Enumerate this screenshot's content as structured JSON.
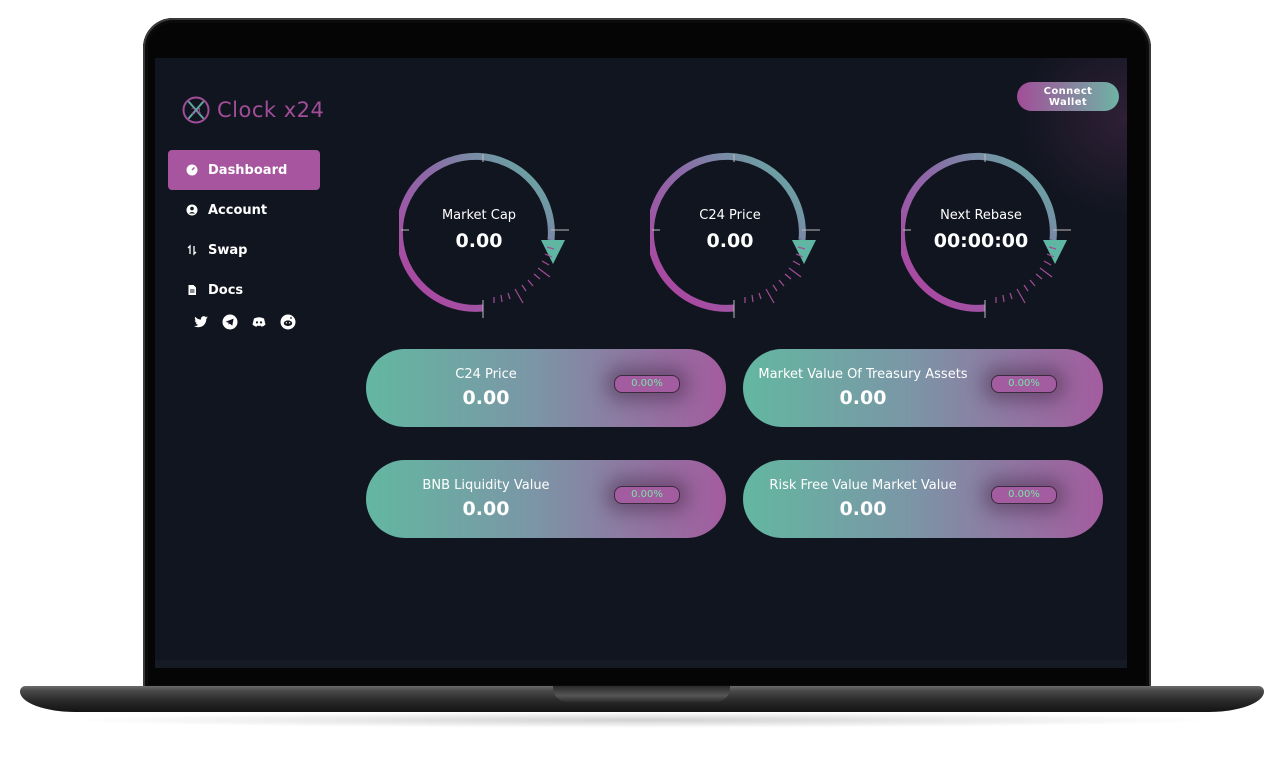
{
  "brand": {
    "name": "Clock x24"
  },
  "header": {
    "connect_wallet_label": "Connect Wallet"
  },
  "sidebar": {
    "items": [
      {
        "label": "Dashboard",
        "icon": "dashboard-icon",
        "active": true
      },
      {
        "label": "Account",
        "icon": "account-icon",
        "active": false
      },
      {
        "label": "Swap",
        "icon": "swap-icon",
        "active": false
      },
      {
        "label": "Docs",
        "icon": "docs-icon",
        "active": false
      }
    ],
    "socials": [
      "twitter-icon",
      "telegram-icon",
      "discord-icon",
      "reddit-icon"
    ]
  },
  "gauges": [
    {
      "label": "Market Cap",
      "value": "0.00"
    },
    {
      "label": "C24 Price",
      "value": "0.00"
    },
    {
      "label": "Next Rebase",
      "value": "00:00:00"
    }
  ],
  "cards": [
    {
      "title": "C24 Price",
      "value": "0.00",
      "change": "0.00%"
    },
    {
      "title": "Market Value Of Treasury Assets",
      "value": "0.00",
      "change": "0.00%"
    },
    {
      "title": "BNB Liquidity Value",
      "value": "0.00",
      "change": "0.00%"
    },
    {
      "title": "Risk Free Value Market Value",
      "value": "0.00",
      "change": "0.00%"
    }
  ],
  "colors": {
    "accent_purple": "#a7559e",
    "accent_teal": "#63b7a1",
    "background": "#111520",
    "badge_text": "#7be3a8"
  }
}
